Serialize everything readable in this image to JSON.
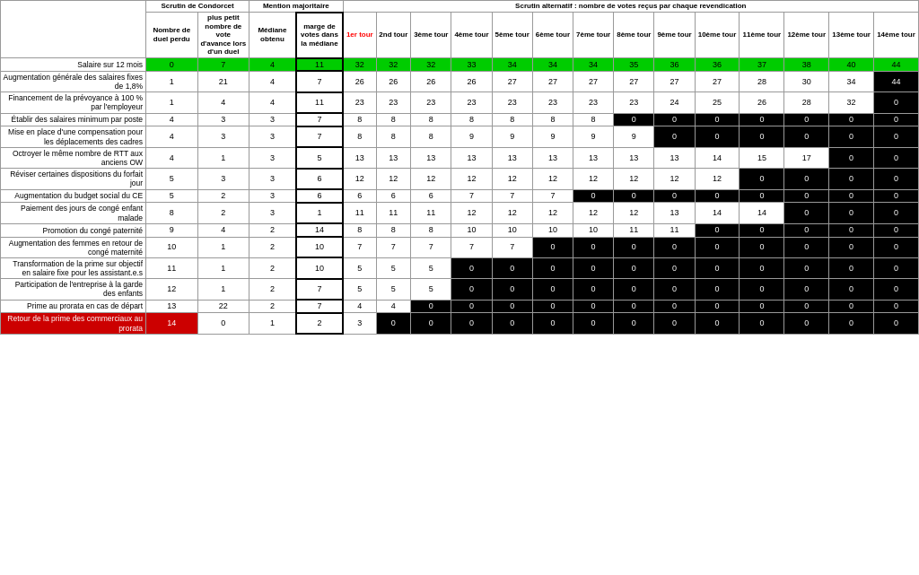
{
  "title": "Scrutin alternatif : nombre de votes reçus par chaque revendication",
  "headers": {
    "condorcet": "Scrutin de Condorcet",
    "mention": "Mention majoritaire",
    "alternating": "Scrutin alternatif : nombre de votes reçus par chaque revendication",
    "nb_duel_perdu": "Nombre de duel perdu",
    "plus_petit": "plus petit nombre de vote d'avance lors d'un duel",
    "mediane": "Médiane obtenu",
    "marge": "marge de votes dans la médiane",
    "tour1": "1er tour",
    "tour2": "2nd tour",
    "tour3": "3ème tour",
    "tour4": "4ème tour",
    "tour5": "5ème tour",
    "tour6": "6ème tour",
    "tour7": "7ème tour",
    "tour8": "8ème tour",
    "tour9": "9ème tour",
    "tour10": "10ème tour",
    "tour11": "11ème tour",
    "tour12": "12ème tour",
    "tour13": "13ème tour",
    "tour14": "14ème tour"
  },
  "rows": [
    {
      "label": "Salaire sur 12 mois",
      "duel_perdu": 0,
      "ppna": 7,
      "mediane": 4,
      "marge": 11,
      "t1": 32,
      "t2": 32,
      "t3": 32,
      "t4": 33,
      "t5": 34,
      "t6": 34,
      "t7": 34,
      "t8": 35,
      "t9": 36,
      "t10": 36,
      "t11": 37,
      "t12": 38,
      "t13": 40,
      "t14": 44,
      "style": "green",
      "t1_style": "green",
      "eliminated_after": 14
    },
    {
      "label": "Augmentation générale des salaires fixes de 1,8%",
      "duel_perdu": 1,
      "ppna": 21,
      "mediane": 4,
      "marge": 7,
      "t1": 26,
      "t2": 26,
      "t3": 26,
      "t4": 26,
      "t5": 27,
      "t6": 27,
      "t7": 27,
      "t8": 27,
      "t9": 27,
      "t10": 27,
      "t11": 28,
      "t12": 30,
      "t13": 34,
      "t14": 44,
      "style": "white",
      "t14_style": "black",
      "eliminated_after": 14
    },
    {
      "label": "Financement de la prévoyance à 100 % par l'employeur",
      "duel_perdu": 1,
      "ppna": 4,
      "mediane": 4,
      "marge": 11,
      "t1": 23,
      "t2": 23,
      "t3": 23,
      "t4": 23,
      "t5": 23,
      "t6": 23,
      "t7": 23,
      "t8": 23,
      "t9": 24,
      "t10": 25,
      "t11": 26,
      "t12": 28,
      "t13": 32,
      "t14": 0,
      "style": "white",
      "eliminated_after": 13,
      "t14_style": "black"
    },
    {
      "label": "Établir des salaires minimum par poste",
      "duel_perdu": 4,
      "ppna": 3,
      "mediane": 3,
      "marge": 7,
      "t1": 8,
      "t2": 8,
      "t3": 8,
      "t4": 8,
      "t5": 8,
      "t6": 8,
      "t7": 8,
      "t8_style": "black",
      "t8": 0,
      "t9": 0,
      "t10": 0,
      "t11": 0,
      "t12": 0,
      "t13": 0,
      "t14": 0,
      "style": "white",
      "eliminated_after": 7
    },
    {
      "label": "Mise en place d'une compensation pour les déplacements des cadres",
      "duel_perdu": 4,
      "ppna": 3,
      "mediane": 3,
      "marge": 7,
      "t1": 8,
      "t2": 8,
      "t3": 8,
      "t4": 9,
      "t5": 9,
      "t6": 9,
      "t7": 9,
      "t8": 9,
      "t8_style": "black",
      "t9": 0,
      "t10": 0,
      "t11": 0,
      "t12": 0,
      "t13": 0,
      "t14": 0,
      "style": "white",
      "eliminated_after": 8
    },
    {
      "label": "Octroyer le même nombre de RTT aux anciens OW",
      "duel_perdu": 4,
      "ppna": 1,
      "mediane": 3,
      "marge": 5,
      "t1": 13,
      "t2": 13,
      "t3": 13,
      "t4": 13,
      "t5": 13,
      "t6": 13,
      "t7": 13,
      "t8": 13,
      "t9": 13,
      "t10": 14,
      "t11": 15,
      "t12": 17,
      "t13_style": "black",
      "t13": 0,
      "t14": 0,
      "style": "white",
      "eliminated_after": 12
    },
    {
      "label": "Réviser certaines dispositions du forfait jour",
      "duel_perdu": 5,
      "ppna": 3,
      "mediane": 3,
      "marge": 6,
      "t1": 12,
      "t2": 12,
      "t3": 12,
      "t4": 12,
      "t5": 12,
      "t6": 12,
      "t7": 12,
      "t8": 12,
      "t9": 12,
      "t10": 12,
      "t11_style": "black",
      "t11": 0,
      "t12": 0,
      "t13": 0,
      "t14": 0,
      "style": "white",
      "eliminated_after": 10
    },
    {
      "label": "Augmentation du budget social du CE",
      "duel_perdu": 5,
      "ppna": 2,
      "mediane": 3,
      "marge": 6,
      "t1": 6,
      "t2": 6,
      "t3": 6,
      "t4": 7,
      "t5": 7,
      "t6": 7,
      "t7_style": "black",
      "t7": 0,
      "t8": 0,
      "t9": 0,
      "t10": 0,
      "t11": 0,
      "t12": 0,
      "t13": 0,
      "t14": 0,
      "style": "white",
      "eliminated_after": 6
    },
    {
      "label": "Paiement des jours de congé enfant malade",
      "duel_perdu": 8,
      "ppna": 2,
      "mediane": 3,
      "marge": 1,
      "t1": 11,
      "t2": 11,
      "t3": 11,
      "t4": 12,
      "t5": 12,
      "t6": 12,
      "t7": 12,
      "t8": 12,
      "t9": 13,
      "t10": 14,
      "t11": 14,
      "t12_style": "black",
      "t12": 0,
      "t13": 0,
      "t14": 0,
      "style": "white",
      "eliminated_after": 11
    },
    {
      "label": "Promotion du congé paternité",
      "duel_perdu": 9,
      "ppna": 4,
      "mediane": 2,
      "marge": 14,
      "t1": 8,
      "t2": 8,
      "t3": 8,
      "t4": 10,
      "t5": 10,
      "t6": 10,
      "t7": 10,
      "t8": 11,
      "t9": 11,
      "t10_style": "black",
      "t10": 0,
      "t11": 0,
      "t12": 0,
      "t13": 0,
      "t14": 0,
      "style": "white",
      "eliminated_after": 9
    },
    {
      "label": "Augmentation des femmes en retour de congé maternité",
      "duel_perdu": 10,
      "ppna": 1,
      "mediane": 2,
      "marge": 10,
      "t1": 7,
      "t2": 7,
      "t3": 7,
      "t4": 7,
      "t5": 7,
      "t6_style": "black",
      "t6": 0,
      "t7": 0,
      "t8": 0,
      "t9": 0,
      "t10": 0,
      "t11": 0,
      "t12": 0,
      "t13": 0,
      "t14": 0,
      "style": "white",
      "eliminated_after": 5
    },
    {
      "label": "Transformation de la prime sur objectif en salaire fixe pour les assistant.e.s",
      "duel_perdu": 11,
      "ppna": 1,
      "mediane": 2,
      "marge": 10,
      "t1": 5,
      "t2": 5,
      "t3": 5,
      "t4_style": "black",
      "t4": 0,
      "t5": 0,
      "t6": 0,
      "t7": 0,
      "t8": 0,
      "t9": 0,
      "t10": 0,
      "t11": 0,
      "t12": 0,
      "t13": 0,
      "t14": 0,
      "style": "white",
      "eliminated_after": 3
    },
    {
      "label": "Participation de l'entreprise à la garde des enfants",
      "duel_perdu": 12,
      "ppna": 1,
      "mediane": 2,
      "marge": 7,
      "t1": 5,
      "t2": 5,
      "t3": 5,
      "t4_style": "black",
      "t4": 0,
      "t5": 0,
      "t6": 0,
      "t7": 0,
      "t8": 0,
      "t9": 0,
      "t10": 0,
      "t11": 0,
      "t12": 0,
      "t13": 0,
      "t14": 0,
      "style": "white",
      "eliminated_after": 3
    },
    {
      "label": "Prime au prorata en cas de départ",
      "duel_perdu": 13,
      "ppna": 22,
      "mediane": 2,
      "marge": 7,
      "t1": 4,
      "t2": 4,
      "t3_style": "black",
      "t3": 0,
      "t4": 0,
      "t5": 0,
      "t6": 0,
      "t7": 0,
      "t8": 0,
      "t9": 0,
      "t10": 0,
      "t11": 0,
      "t12": 0,
      "t13": 0,
      "t14": 0,
      "style": "white",
      "eliminated_after": 2
    },
    {
      "label": "Retour de la prime des commerciaux au prorata",
      "duel_perdu": 14,
      "ppna": 0,
      "mediane": 1,
      "marge": 2,
      "t1": 3,
      "t2_style": "black",
      "t2": 0,
      "t3": 0,
      "t4": 0,
      "t5": 0,
      "t6": 0,
      "t7": 0,
      "t8": 0,
      "t9": 0,
      "t10": 0,
      "t11": 0,
      "t12": 0,
      "t13": 0,
      "t14": 0,
      "style": "red",
      "eliminated_after": 1
    }
  ]
}
